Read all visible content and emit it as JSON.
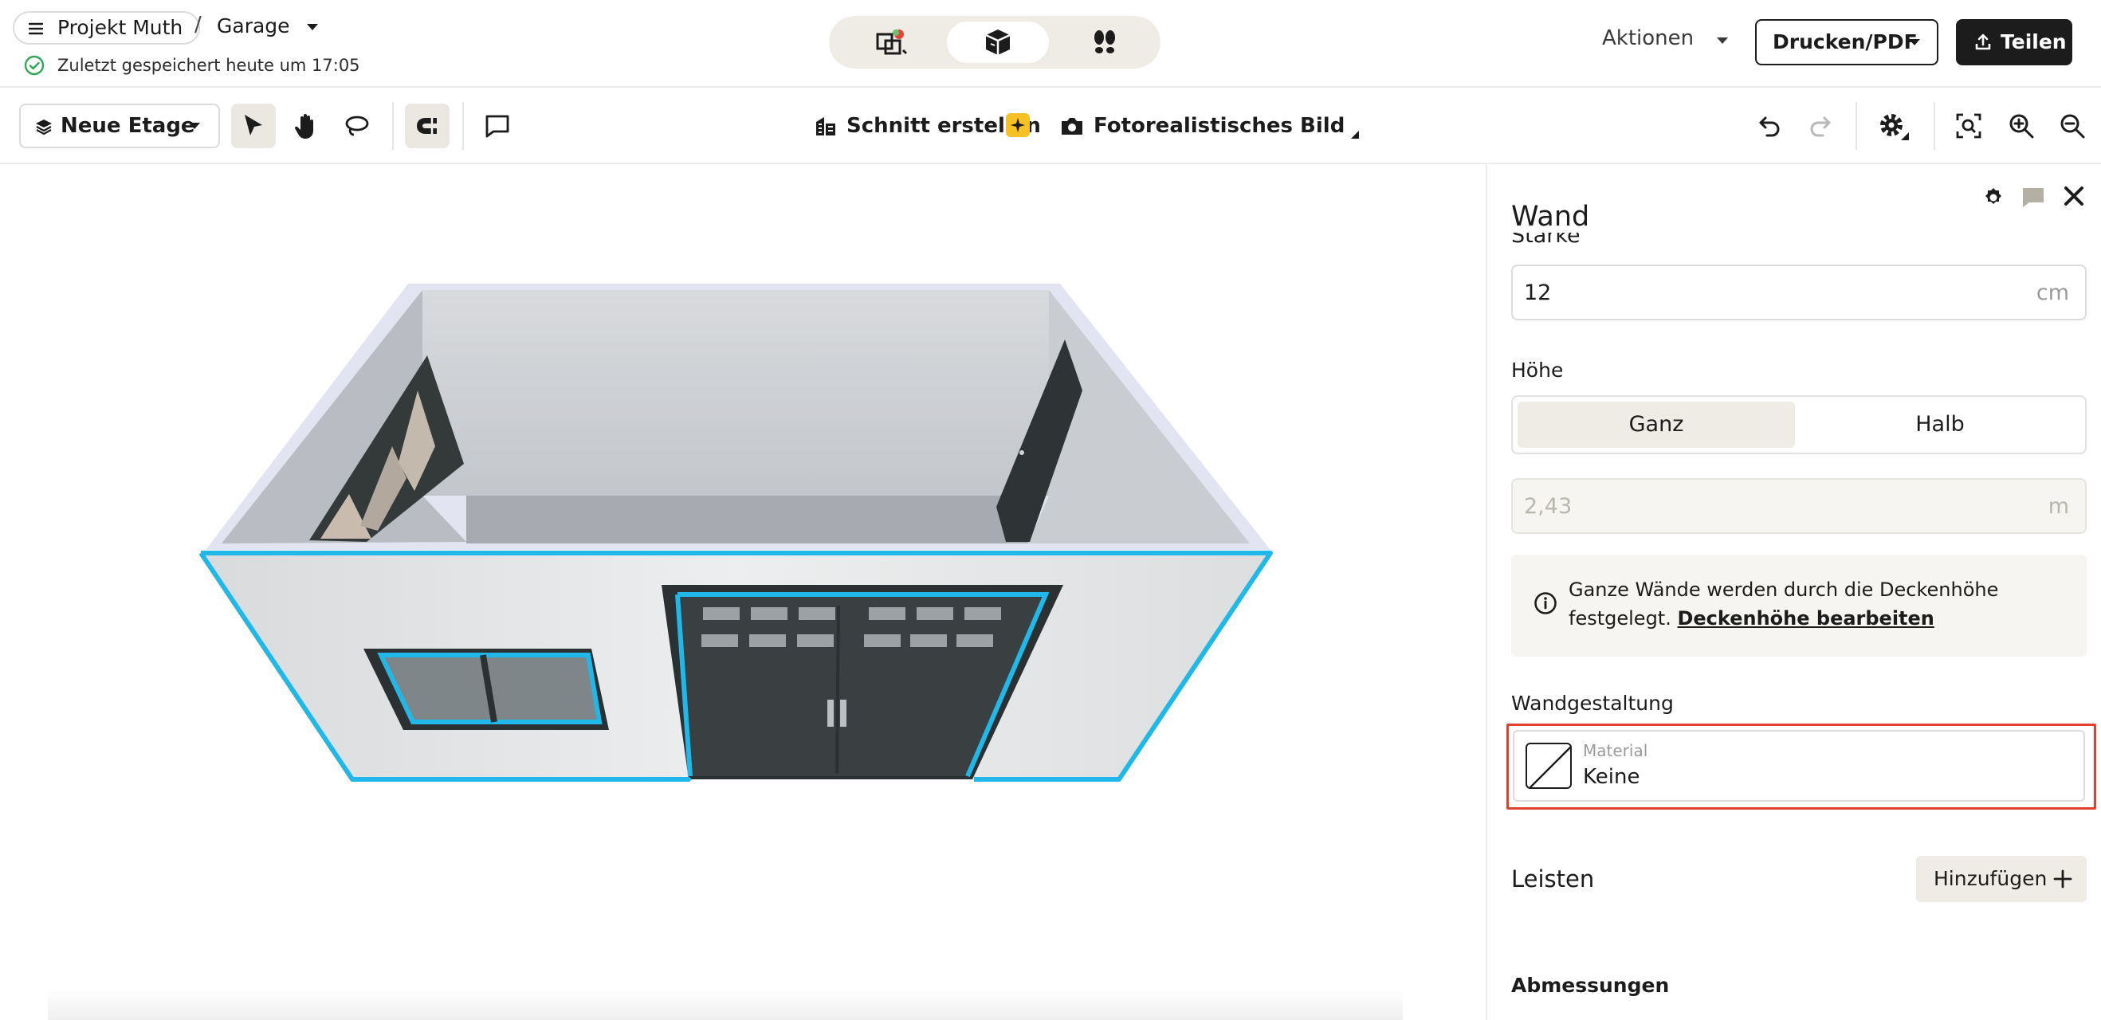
{
  "header": {
    "project_label": "Projekt Muth",
    "crumb_separator": "/",
    "floor_label": "Garage",
    "saved_text": "Zuletzt gespeichert heute um 17:05",
    "view_modes": [
      "2d-plan-icon",
      "3d-box-icon",
      "walkthrough-icon"
    ],
    "active_view": "3d-box-icon",
    "actions_label": "Aktionen",
    "print_label": "Drucken/PDF",
    "share_label": "Teilen"
  },
  "toolbar": {
    "floor_button_label": "Neue Etage",
    "tools": [
      "select-cursor-icon",
      "pan-hand-icon",
      "lasso-icon",
      "magnet-icon",
      "comment-icon"
    ],
    "section_label": "Schnitt erstellen",
    "photo_label": "Fotorealistisches Bild",
    "right_tools": [
      "undo-icon",
      "redo-icon",
      "settings-icon",
      "zoom-fit-icon",
      "zoom-in-icon",
      "zoom-out-icon"
    ]
  },
  "panel": {
    "title": "Wand",
    "thickness_label": "Stärke",
    "thickness_value": "12",
    "thickness_unit": "cm",
    "height_label": "Höhe",
    "height_options": [
      "Ganz",
      "Halb"
    ],
    "height_selected": "Ganz",
    "height_value": "2,43",
    "height_unit": "m",
    "info_text": "Ganze Wände werden durch die Deckenhöhe festgelegt.",
    "info_link": "Deckenhöhe bearbeiten",
    "wall_design_label": "Wandgestaltung",
    "material_label": "Material",
    "material_value": "Keine",
    "trims_label": "Leisten",
    "add_label": "Hinzufügen",
    "dimensions_label": "Abmessungen"
  },
  "colors": {
    "accent_dark": "#1c1c1c",
    "selection_outline": "#1fb8e8",
    "highlight_frame": "#e0402c",
    "segment_active": "#efebe5",
    "spark_badge": "#f6c122"
  }
}
